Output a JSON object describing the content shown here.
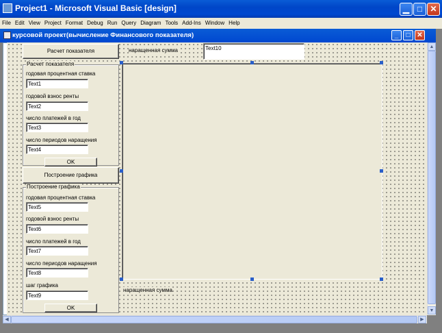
{
  "window": {
    "title": "Project1 - Microsoft Visual Basic [design]"
  },
  "menu": [
    "File",
    "Edit",
    "View",
    "Project",
    "Format",
    "Debug",
    "Run",
    "Query",
    "Diagram",
    "Tools",
    "Add-Ins",
    "Window",
    "Help"
  ],
  "child": {
    "title": "курсовой проект(вычисление Финансового показателя)"
  },
  "form": {
    "calc_button": "Расчет показателя",
    "top_label": "наращенная сумма",
    "top_text": "Text10",
    "frame1": {
      "caption": "Расчет показателя",
      "fields": [
        {
          "label": "годовая процентная ставка",
          "value": "Text1"
        },
        {
          "label": "годовой взнос ренты",
          "value": "Text2"
        },
        {
          "label": "число платежей в год",
          "value": "Text3"
        },
        {
          "label": "число периодов наращения",
          "value": "Text4"
        }
      ],
      "ok": "OK"
    },
    "graph_button": "Построение графика",
    "frame2": {
      "caption": "Построение графика",
      "fields": [
        {
          "label": "годовая процентная ставка",
          "value": "Text5"
        },
        {
          "label": "годовой взнос ренты",
          "value": "Text6"
        },
        {
          "label": "число платежей в год",
          "value": "Text7"
        },
        {
          "label": "число периодов наращения",
          "value": "Text8"
        },
        {
          "label": "шаг графика",
          "value": "Text9"
        }
      ],
      "ok": "OK"
    },
    "bottom_label": "наращенная сумма"
  },
  "colors": {
    "titlebar": "#0046c8",
    "form_bg": "#ece9d8",
    "selection_handle": "#2a5fc9"
  },
  "icons": [
    "vb-app-icon",
    "form-icon",
    "minimize-icon",
    "maximize-icon",
    "close-icon"
  ]
}
